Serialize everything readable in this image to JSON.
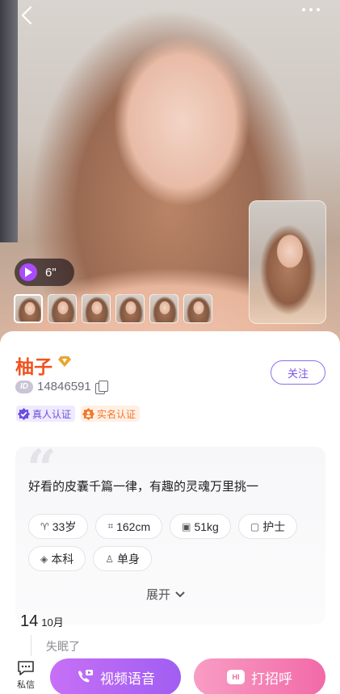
{
  "media": {
    "duration": "6\"",
    "thumbnail_count": 6
  },
  "profile": {
    "name": "柚子",
    "id_label": "ID",
    "id_number": "14846591",
    "follow_label": "关注",
    "badges": [
      {
        "label": "真人认证",
        "color": "#6b4ee0"
      },
      {
        "label": "实名认证",
        "color": "#f3782d"
      }
    ],
    "bio": "好看的皮囊千篇一律，有趣的灵魂万里挑一",
    "tags": [
      {
        "icon": "age-icon",
        "label": "33岁"
      },
      {
        "icon": "height-icon",
        "label": "162cm"
      },
      {
        "icon": "weight-icon",
        "label": "51kg"
      },
      {
        "icon": "job-icon",
        "label": "护士"
      },
      {
        "icon": "education-icon",
        "label": "本科"
      },
      {
        "icon": "person-icon",
        "label": "单身"
      }
    ],
    "expand_label": "展开"
  },
  "moment": {
    "day": "14",
    "month": "10月",
    "text": "失眠了"
  },
  "bottom_bar": {
    "message_label": "私信",
    "video_label": "视频语音",
    "greet_label": "打招呼",
    "greet_badge": "HI"
  },
  "colors": {
    "name": "#f2521f",
    "accent_purple": "#a05ef2",
    "accent_pink": "#f26aa8"
  }
}
